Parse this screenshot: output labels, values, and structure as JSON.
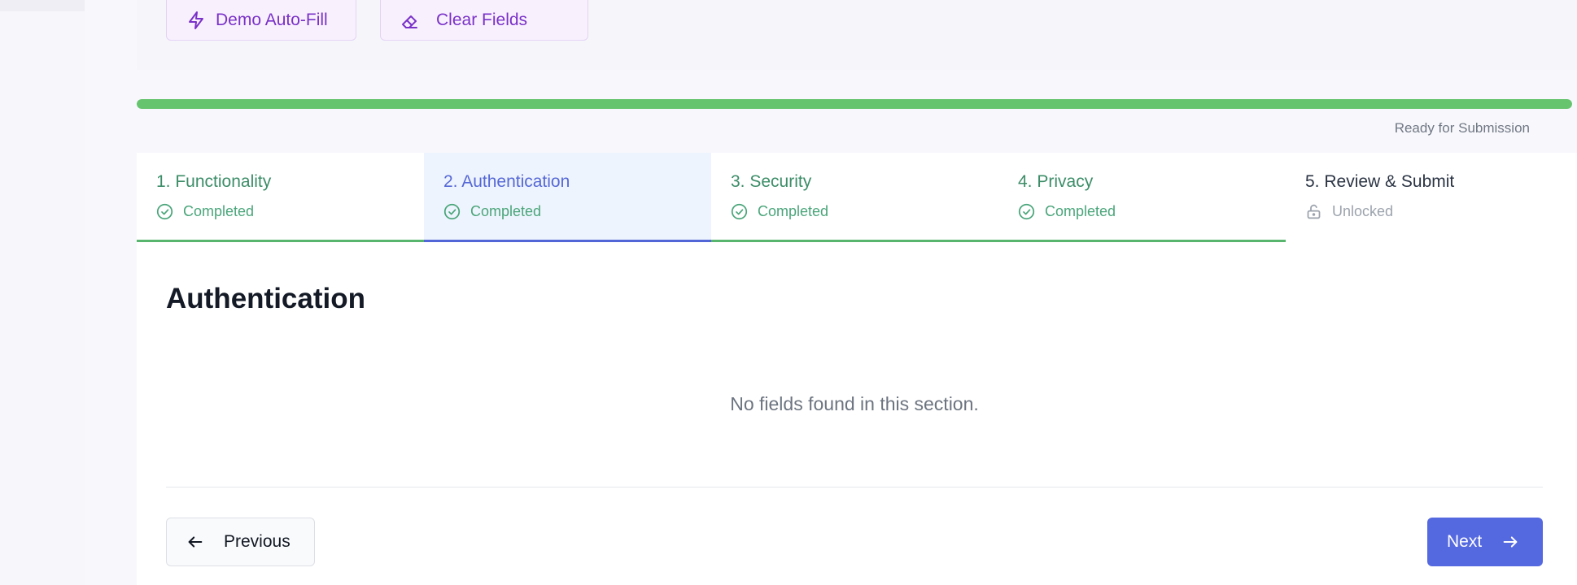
{
  "toolbar": {
    "autofill_label": "Demo Auto-Fill",
    "autofill_icon": "lightning-icon",
    "clear_label": "Clear Fields",
    "clear_icon": "eraser-icon"
  },
  "progress": {
    "percent": 100,
    "status": "Ready for Submission",
    "color": "#66c46f"
  },
  "steps": [
    {
      "label": "1. Functionality",
      "status": "Completed",
      "state": "completed",
      "icon": "check-circle-icon"
    },
    {
      "label": "2. Authentication",
      "status": "Completed",
      "state": "active",
      "icon": "check-circle-icon"
    },
    {
      "label": "3. Security",
      "status": "Completed",
      "state": "completed",
      "icon": "check-circle-icon"
    },
    {
      "label": "4. Privacy",
      "status": "Completed",
      "state": "completed",
      "icon": "check-circle-icon"
    },
    {
      "label": "5. Review & Submit",
      "status": "Unlocked",
      "state": "unlocked",
      "icon": "unlock-icon"
    }
  ],
  "section": {
    "title": "Authentication",
    "empty_message": "No fields found in this section."
  },
  "nav": {
    "previous_label": "Previous",
    "next_label": "Next"
  },
  "colors": {
    "accent": "#5468e0",
    "success": "#4aa57a",
    "purple": "#7a31c8"
  }
}
